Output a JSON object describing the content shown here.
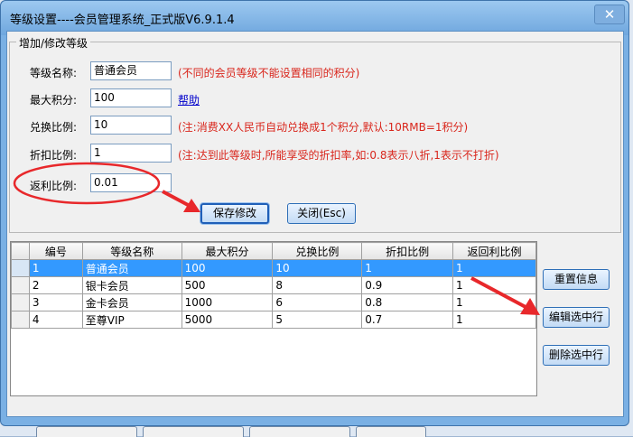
{
  "window": {
    "title": "等级设置----会员管理系统_正式版V6.9.1.4",
    "close_glyph": "✕"
  },
  "groupbox": {
    "legend": "增加/修改等级"
  },
  "form": {
    "level_name": {
      "label": "等级名称:",
      "value": "普通会员",
      "note": "(不同的会员等级不能设置相同的积分)"
    },
    "max_points": {
      "label": "最大积分:",
      "value": "100",
      "help": "帮助"
    },
    "exchange_ratio": {
      "label": "兑换比例:",
      "value": "10",
      "note": "(注:消费XX人民币自动兑换成1个积分,默认:10RMB=1积分)"
    },
    "discount_ratio": {
      "label": "折扣比例:",
      "value": "1",
      "note": "(注:达到此等级时,所能享受的折扣率,如:0.8表示八折,1表示不打折)"
    },
    "rebate_ratio": {
      "label": "返利比例:",
      "value": "0.01"
    }
  },
  "buttons": {
    "save": "保存修改",
    "close": "关闭(Esc)",
    "reset": "重置信息",
    "edit": "编辑选中行",
    "delete": "删除选中行"
  },
  "table": {
    "headers": [
      "编号",
      "等级名称",
      "最大积分",
      "兑换比例",
      "折扣比例",
      "返回利比例"
    ],
    "rows": [
      [
        "1",
        "普通会员",
        "100",
        "10",
        "1",
        "1"
      ],
      [
        "2",
        "银卡会员",
        "500",
        "8",
        "0.9",
        "1"
      ],
      [
        "3",
        "金卡会员",
        "1000",
        "6",
        "0.8",
        "1"
      ],
      [
        "4",
        "至尊VIP",
        "5000",
        "5",
        "0.7",
        "1"
      ]
    ],
    "selected_row": 0
  },
  "colors": {
    "annotation": "#e8282b",
    "note": "#d9261c",
    "selection": "#3399ff"
  }
}
